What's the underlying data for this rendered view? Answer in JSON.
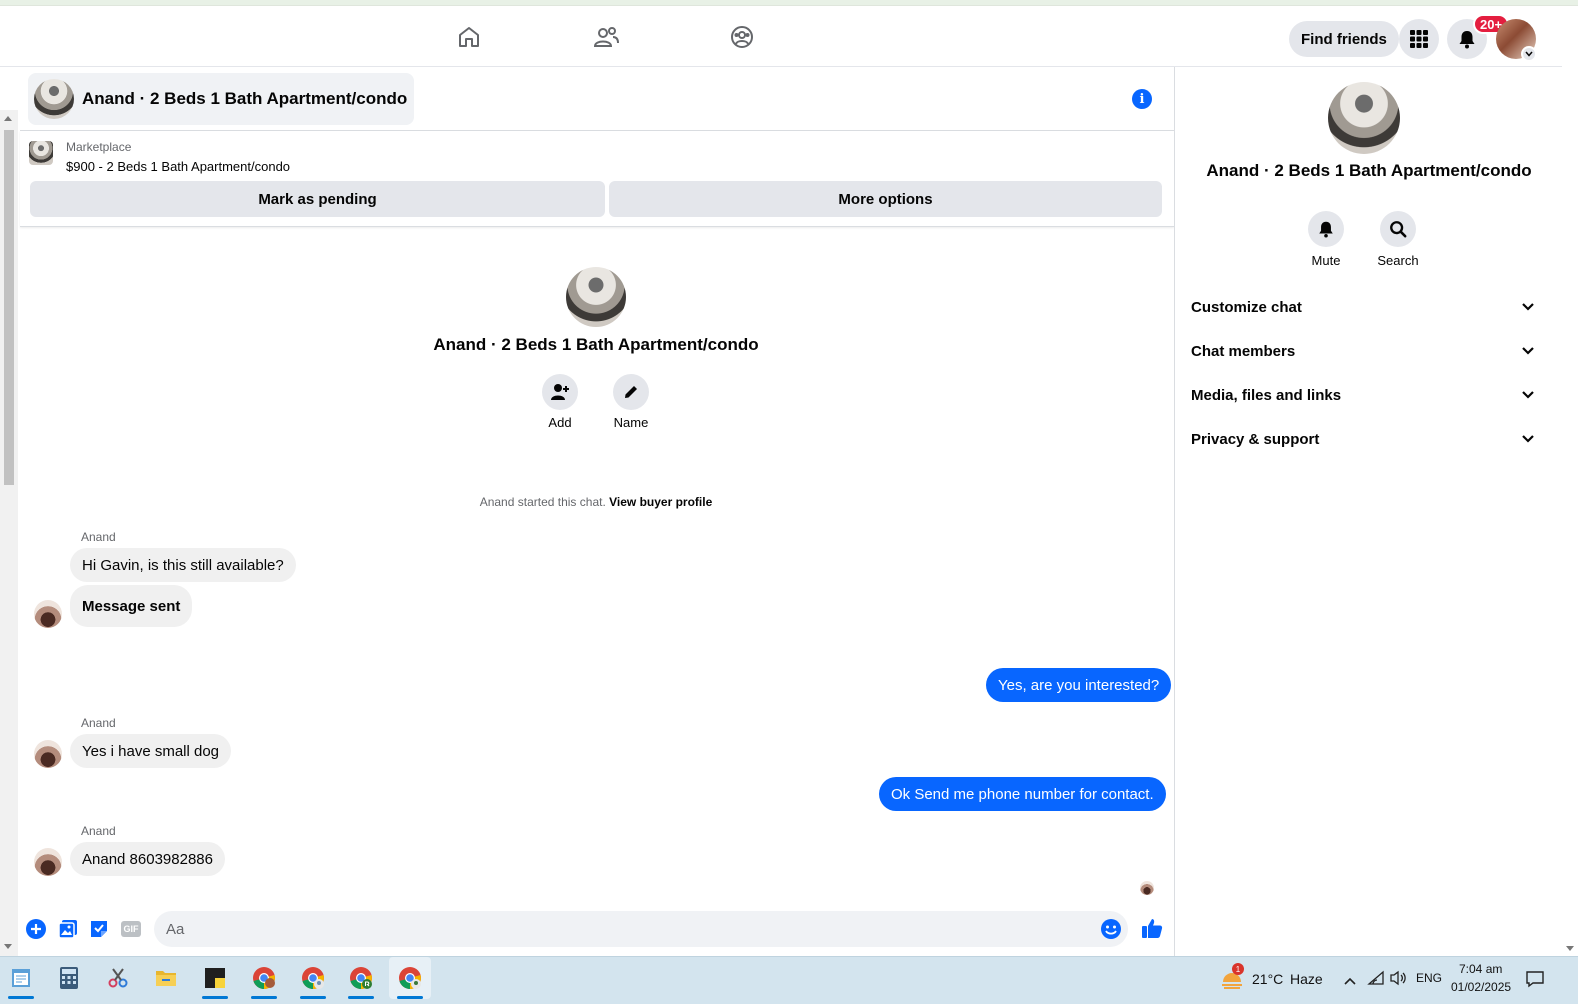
{
  "nav": {
    "find_friends": "Find friends",
    "notification_count": "20+"
  },
  "chat": {
    "header_title": "Anand · 2 Beds 1 Bath Apartment/condo",
    "marketplace_label": "Marketplace",
    "listing": "$900 - 2 Beds 1 Bath Apartment/condo",
    "mark_pending": "Mark as pending",
    "more_options": "More options",
    "intro_name": "Anand · 2 Beds 1 Bath Apartment/condo",
    "intro_add": "Add",
    "intro_name_action": "Name",
    "started_text": "Anand started this chat.",
    "buyer_profile_link": "View buyer profile"
  },
  "messages": [
    {
      "sender": "Anand",
      "text": "Hi Gavin, is this still available?"
    },
    {
      "sender": "Anand",
      "text": "Message sent"
    },
    {
      "sender": "me",
      "text": "Yes, are you interested?"
    },
    {
      "sender": "Anand",
      "text": "Yes i have small dog"
    },
    {
      "sender": "me",
      "text": "Ok Send me phone number for contact."
    },
    {
      "sender": "Anand",
      "text": "Anand 8603982886"
    }
  ],
  "composer": {
    "placeholder": "Aa",
    "gif_label": "GIF"
  },
  "right_panel": {
    "name": "Anand · 2 Beds 1 Bath Apartment/condo",
    "mute": "Mute",
    "search": "Search",
    "sections": [
      "Customize chat",
      "Chat members",
      "Media, files and links",
      "Privacy & support"
    ]
  },
  "taskbar": {
    "weather_badge": "1",
    "temperature": "21°C",
    "weather": "Haze",
    "language": "ENG",
    "time": "7:04 am",
    "date": "01/02/2025"
  },
  "colors": {
    "accent": "#0866ff",
    "bubble_in": "#f0f0f0",
    "button_grey": "#e4e6eb",
    "badge_red": "#e41e3f"
  }
}
